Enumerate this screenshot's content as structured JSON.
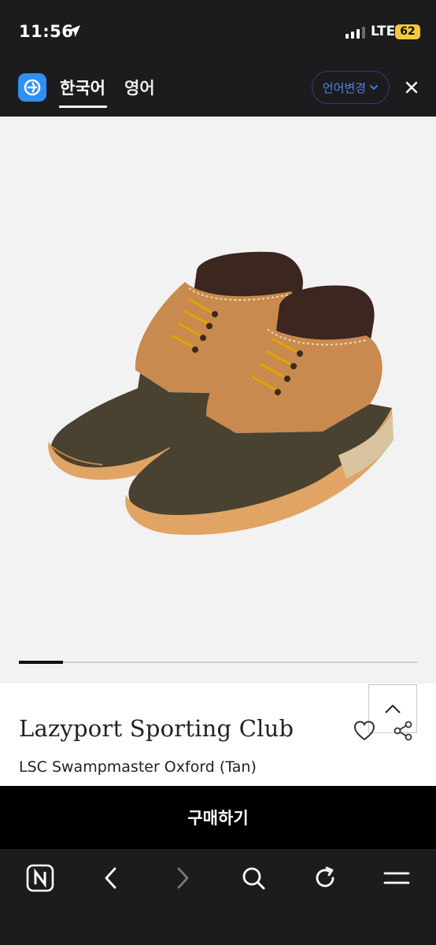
{
  "status_bar": {
    "time": "11:56",
    "network": "LTE",
    "battery": "62",
    "battery_color": "#f3c83b"
  },
  "translate_bar": {
    "tabs": [
      {
        "label": "한국어",
        "active": true
      },
      {
        "label": "영어",
        "active": false
      }
    ],
    "change_language_label": "언어변경",
    "accent_color": "#4f7ff2",
    "logo_color": "#2f8ff5"
  },
  "product": {
    "brand": "Lazyport Sporting Club",
    "name": "LSC Swampmaster Oxford (Tan)",
    "image_icon": "duck-boots-image",
    "carousel_progress": 0.11
  },
  "buy_button": {
    "label": "구매하기"
  },
  "browser_toolbar": {
    "items": [
      "naver-home-icon",
      "back-arrow-icon",
      "forward-arrow-icon",
      "search-icon",
      "reload-icon",
      "menu-icon"
    ]
  }
}
